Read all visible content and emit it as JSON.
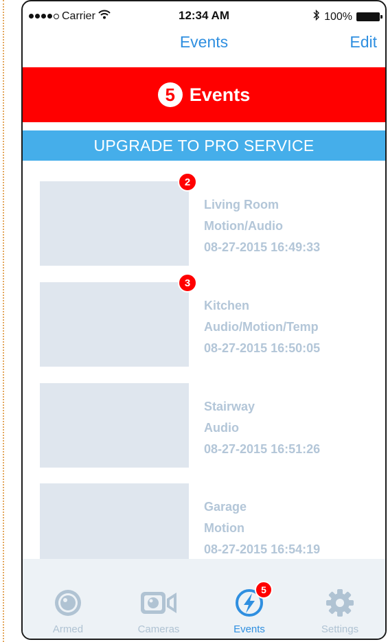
{
  "status_bar": {
    "carrier": "Carrier",
    "time": "12:34 AM",
    "battery": "100%",
    "signal_icon": "signal-dots-icon",
    "wifi_icon": "wifi-icon",
    "bluetooth_icon": "bluetooth-icon",
    "battery_icon": "battery-icon"
  },
  "nav": {
    "title": "Events",
    "edit_label": "Edit"
  },
  "banner": {
    "count": "5",
    "label": "Events"
  },
  "upgrade": {
    "label": "UPGRADE TO PRO SERVICE"
  },
  "events": [
    {
      "badge": "2",
      "location": "Living Room",
      "type": "Motion/Audio",
      "timestamp": "08-27-2015 16:49:33"
    },
    {
      "badge": "3",
      "location": "Kitchen",
      "type": "Audio/Motion/Temp",
      "timestamp": "08-27-2015 16:50:05"
    },
    {
      "badge": "",
      "location": "Stairway",
      "type": "Audio",
      "timestamp": "08-27-2015 16:51:26"
    },
    {
      "badge": "",
      "location": "Garage",
      "type": "Motion",
      "timestamp": "08-27-2015 16:54:19"
    }
  ],
  "tabs": [
    {
      "label": "Armed",
      "icon": "camera-lens-icon",
      "active": false
    },
    {
      "label": "Cameras",
      "icon": "video-camera-icon",
      "active": false
    },
    {
      "label": "Events",
      "icon": "lightning-bolt-icon",
      "active": true,
      "badge": "5"
    },
    {
      "label": "Settings",
      "icon": "gear-icon",
      "active": false
    }
  ],
  "colors": {
    "accent": "#2f8fe0",
    "banner_red": "#ff0000",
    "upgrade_blue": "#45aeea",
    "event_text": "#b3c6d8",
    "thumbnail": "#dfe6ee",
    "tab_bar": "#edf2f6",
    "inactive_tab": "#b0c3d3"
  }
}
